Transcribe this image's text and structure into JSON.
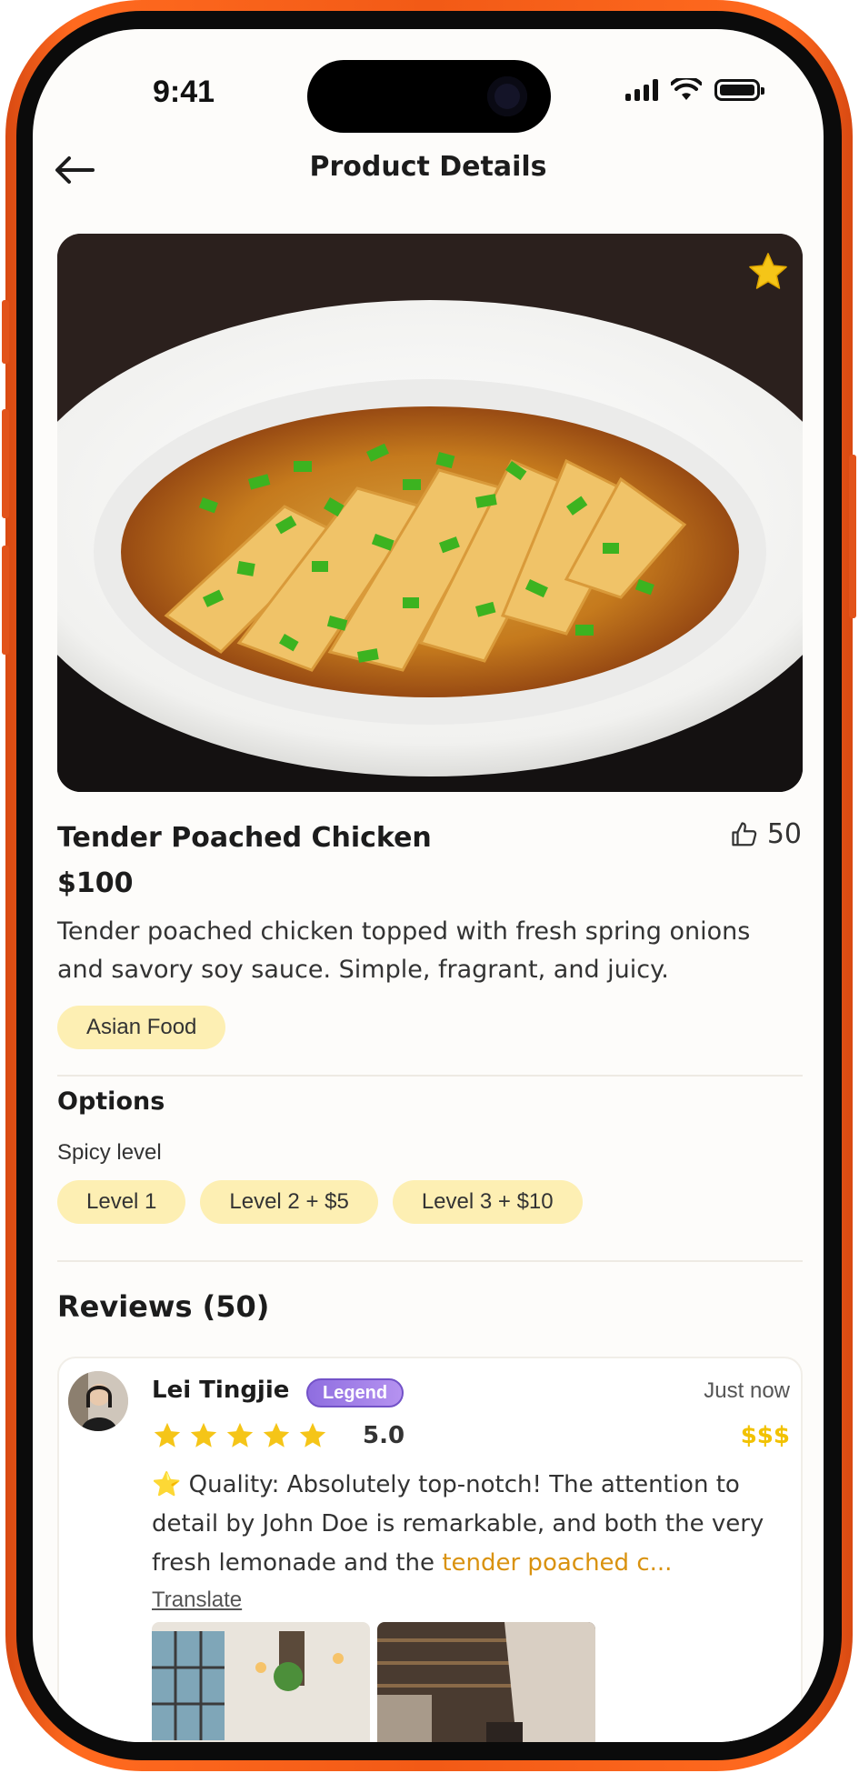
{
  "status_bar": {
    "time": "9:41",
    "icons": [
      "cellular-signal-icon",
      "wifi-icon",
      "battery-icon"
    ]
  },
  "header": {
    "back_icon": "arrow-left-icon",
    "title": "Product Details"
  },
  "hero": {
    "favorite_icon": "star-icon",
    "favorite_color": "#f5c518"
  },
  "product": {
    "name": "Tender Poached Chicken",
    "likes": "50",
    "like_icon": "thumbs-up-icon",
    "price": "$100",
    "description": "Tender poached chicken topped with fresh spring onions and savory soy sauce. Simple, fragrant, and juicy.",
    "category": "Asian Food"
  },
  "options": {
    "title": "Options",
    "spicy_label": "Spicy level",
    "levels": [
      "Level 1",
      "Level 2 + $5",
      "Level 3 + $10"
    ]
  },
  "reviews": {
    "title": "Reviews (50)",
    "items": [
      {
        "name": "Lei Tingjie",
        "badge": "Legend",
        "time": "Just now",
        "stars": 5,
        "rating": "5.0",
        "price_level": "$$$",
        "text_prefix": "⭐ Quality: Absolutely top-notch! The attention to detail by John Doe is remarkable, and both the very fresh lemonade and the ",
        "text_highlight": "tender poached c...",
        "translate": "Translate"
      }
    ]
  },
  "colors": {
    "frame": "#f25a16",
    "chip_bg": "#fdefb3",
    "star": "#f5c518",
    "highlight": "#d9920f"
  }
}
